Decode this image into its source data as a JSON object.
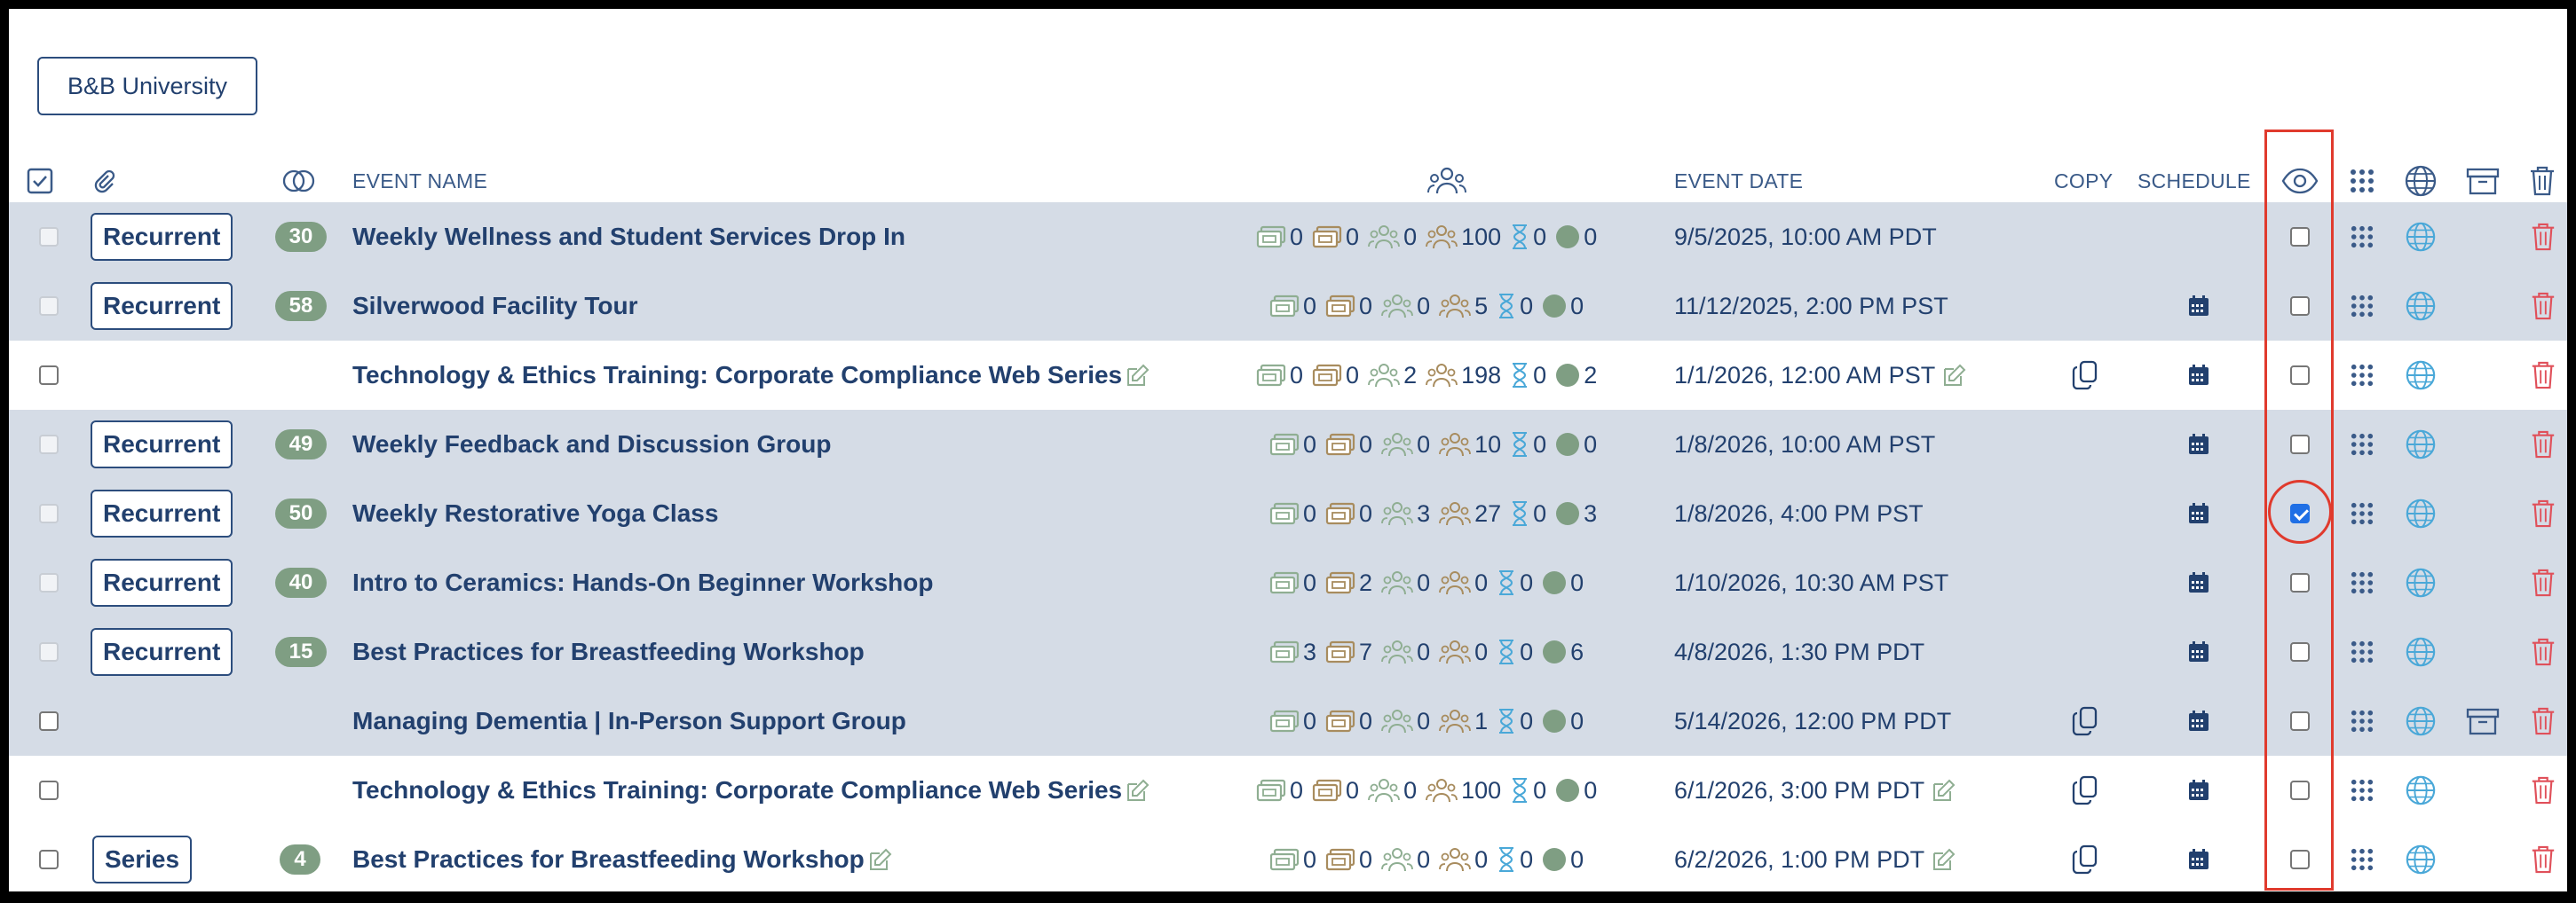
{
  "org_button": "B&B University",
  "headers": {
    "event_name": "EVENT NAME",
    "event_date": "EVENT DATE",
    "copy": "COPY",
    "schedule": "SCHEDULE"
  },
  "icons": {
    "select_all": "checkbox-checked-icon",
    "attachments": "paperclip-icon",
    "occurrences": "overlapping-circles-icon",
    "attendees": "people-group-icon",
    "visibility": "eye-icon",
    "embed": "grid-dots-icon",
    "public": "globe-icon",
    "archive": "archive-box-icon",
    "delete": "trash-icon",
    "copy": "copy-icon",
    "schedule": "calendar-icon",
    "edit": "pencil-edit-icon"
  },
  "colors": {
    "navy": "#22406e",
    "row_gray": "#d5dce6",
    "pill_green": "#7f9e83",
    "trash_red": "#e0505a",
    "globe_blue": "#4aa8d8",
    "highlight_red": "#e03a2d"
  },
  "events": [
    {
      "tag": "Recurrent",
      "count": "30",
      "name": "Weekly Wellness and Student Services Drop In",
      "stats": [
        "0",
        "0",
        "0",
        "100",
        "0",
        "0"
      ],
      "date": "9/5/2025, 10:00 AM PDT",
      "visible": false,
      "copy": false,
      "schedule": false,
      "archive": false,
      "edit": false,
      "style": "gray"
    },
    {
      "tag": "Recurrent",
      "count": "58",
      "name": "Silverwood Facility Tour",
      "stats": [
        "0",
        "0",
        "0",
        "5",
        "0",
        "0"
      ],
      "date": "11/12/2025, 2:00 PM PST",
      "visible": false,
      "copy": false,
      "schedule": true,
      "archive": false,
      "edit": false,
      "style": "gray"
    },
    {
      "tag": "",
      "count": "",
      "name": "Technology & Ethics Training: Corporate Compliance Web Series",
      "stats": [
        "0",
        "0",
        "2",
        "198",
        "0",
        "2"
      ],
      "date": "1/1/2026, 12:00 AM PST",
      "visible": false,
      "copy": true,
      "schedule": true,
      "archive": false,
      "edit": true,
      "style": "white"
    },
    {
      "tag": "Recurrent",
      "count": "49",
      "name": "Weekly Feedback and Discussion Group",
      "stats": [
        "0",
        "0",
        "0",
        "10",
        "0",
        "0"
      ],
      "date": "1/8/2026, 10:00 AM PST",
      "visible": false,
      "copy": false,
      "schedule": true,
      "archive": false,
      "edit": false,
      "style": "gray"
    },
    {
      "tag": "Recurrent",
      "count": "50",
      "name": "Weekly Restorative Yoga Class",
      "stats": [
        "0",
        "0",
        "3",
        "27",
        "0",
        "3"
      ],
      "date": "1/8/2026, 4:00 PM PST",
      "visible": true,
      "copy": false,
      "schedule": true,
      "archive": false,
      "edit": false,
      "style": "gray"
    },
    {
      "tag": "Recurrent",
      "count": "40",
      "name": "Intro to Ceramics: Hands-On Beginner Workshop",
      "stats": [
        "0",
        "2",
        "0",
        "0",
        "0",
        "0"
      ],
      "date": "1/10/2026, 10:30 AM PST",
      "visible": false,
      "copy": false,
      "schedule": true,
      "archive": false,
      "edit": false,
      "style": "gray"
    },
    {
      "tag": "Recurrent",
      "count": "15",
      "name": "Best Practices for Breastfeeding Workshop",
      "stats": [
        "3",
        "7",
        "0",
        "0",
        "0",
        "6"
      ],
      "date": "4/8/2026, 1:30 PM PDT",
      "visible": false,
      "copy": false,
      "schedule": true,
      "archive": false,
      "edit": false,
      "style": "gray"
    },
    {
      "tag": "",
      "count": "",
      "name": "Managing Dementia | In-Person Support Group",
      "stats": [
        "0",
        "0",
        "0",
        "1",
        "0",
        "0"
      ],
      "date": "5/14/2026, 12:00 PM PDT",
      "visible": false,
      "copy": true,
      "schedule": true,
      "archive": true,
      "edit": false,
      "style": "gray"
    },
    {
      "tag": "",
      "count": "",
      "name": "Technology & Ethics Training: Corporate Compliance Web Series",
      "stats": [
        "0",
        "0",
        "0",
        "100",
        "0",
        "0"
      ],
      "date": "6/1/2026, 3:00 PM PDT",
      "visible": false,
      "copy": true,
      "schedule": true,
      "archive": false,
      "edit": true,
      "style": "white"
    },
    {
      "tag": "Series",
      "count": "4",
      "name": "Best Practices for Breastfeeding Workshop",
      "stats": [
        "0",
        "0",
        "0",
        "0",
        "0",
        "0"
      ],
      "date": "6/2/2026, 1:00 PM PDT",
      "visible": false,
      "copy": true,
      "schedule": true,
      "archive": false,
      "edit": true,
      "style": "white"
    }
  ]
}
